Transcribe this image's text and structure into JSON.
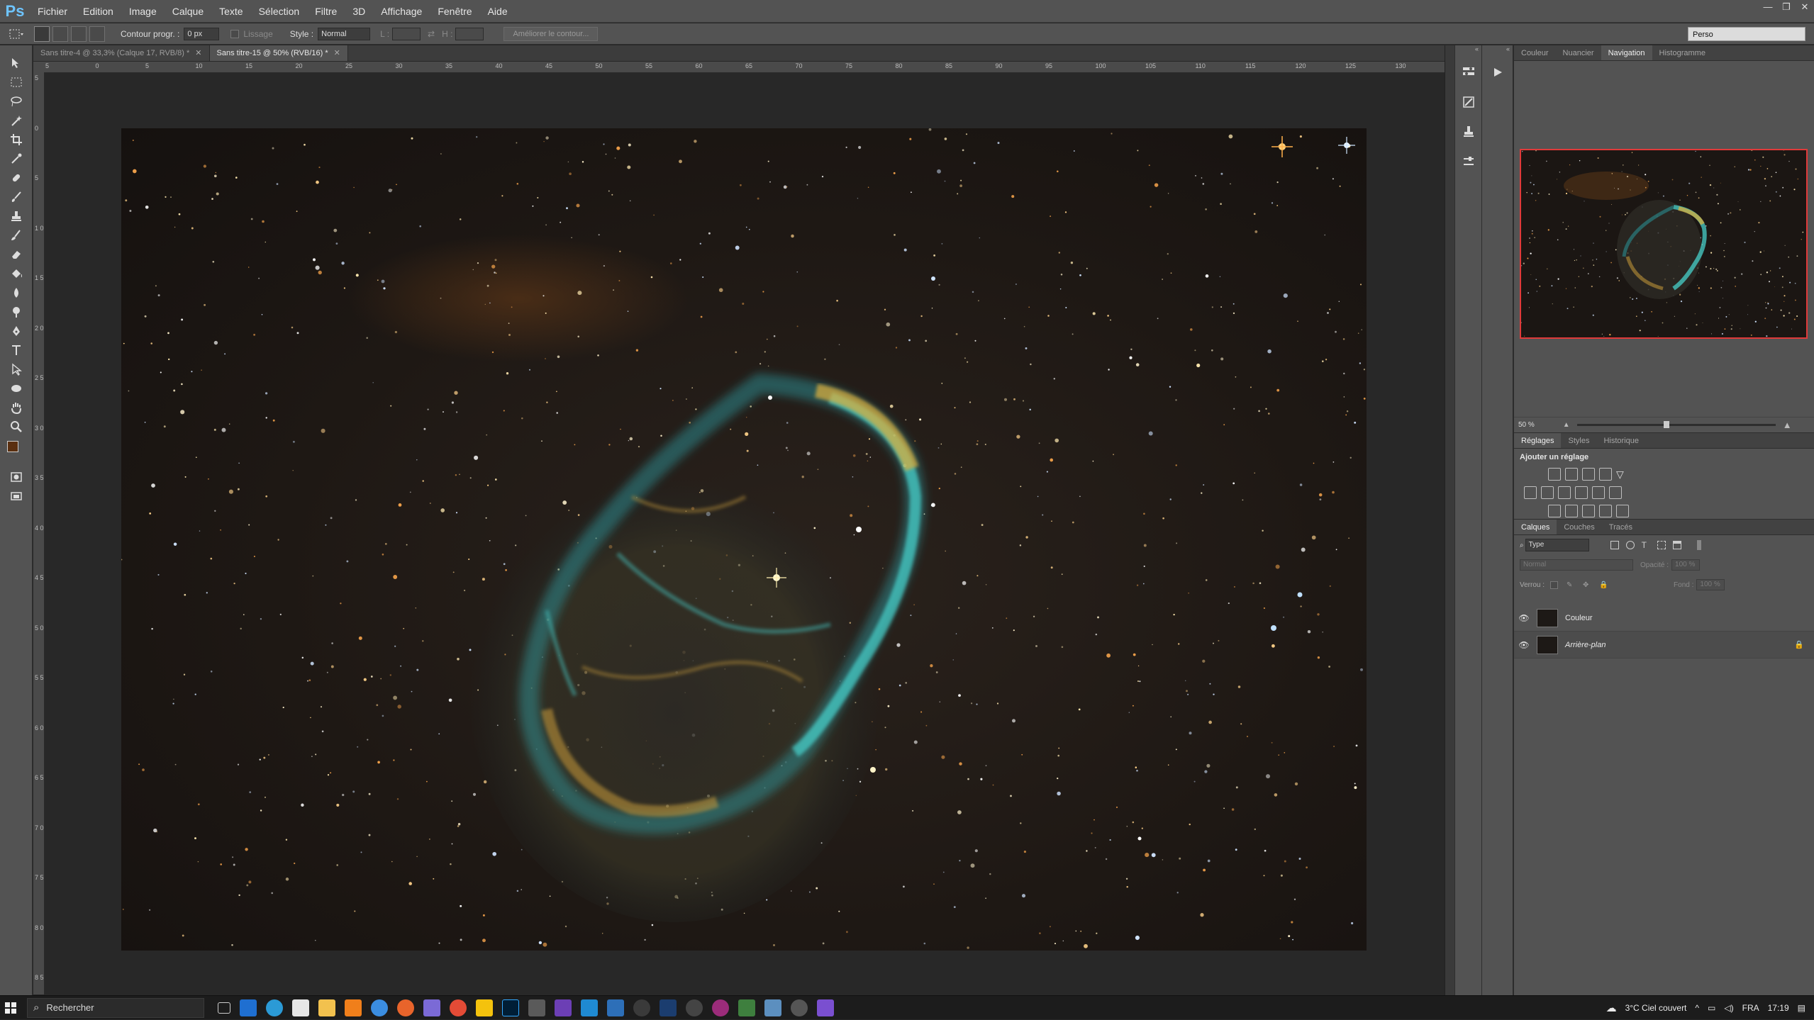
{
  "app": {
    "logo": "Ps",
    "menu": [
      "Fichier",
      "Edition",
      "Image",
      "Calque",
      "Texte",
      "Sélection",
      "Filtre",
      "3D",
      "Affichage",
      "Fenêtre",
      "Aide"
    ],
    "window_controls": [
      "—",
      "❐",
      "✕"
    ]
  },
  "options_bar": {
    "feather_label": "Contour progr. :",
    "feather_value": "0 px",
    "antialias_label": "Lissage",
    "style_label": "Style :",
    "style_value": "Normal",
    "width_label": "L :",
    "height_label": "H :",
    "refine_edge_button": "Améliorer le contour...",
    "workspace": "Perso"
  },
  "tabs": [
    {
      "label": "Sans titre-4 @ 33,3% (Calque 17, RVB/8) *",
      "active": false
    },
    {
      "label": "Sans titre-15 @ 50% (RVB/16) *",
      "active": true
    }
  ],
  "ruler": {
    "h_labels": [
      "5",
      "0",
      "5",
      "10",
      "15",
      "20",
      "25",
      "30",
      "35",
      "40",
      "45",
      "50",
      "55",
      "60",
      "65",
      "70",
      "75",
      "80",
      "85",
      "90",
      "95",
      "100",
      "105",
      "110",
      "115",
      "120",
      "125",
      "130"
    ],
    "v_labels": [
      "5",
      "0",
      "5",
      "1 0",
      "1 5",
      "2 0",
      "2 5",
      "3 0",
      "3 5",
      "4 0",
      "4 5",
      "5 0",
      "5 5",
      "6 0",
      "6 5",
      "7 0",
      "7 5",
      "8 0",
      "8 5"
    ]
  },
  "panels": {
    "top_tabs": [
      {
        "label": "Couleur",
        "active": false
      },
      {
        "label": "Nuancier",
        "active": false
      },
      {
        "label": "Navigation",
        "active": true
      },
      {
        "label": "Histogramme",
        "active": false
      }
    ],
    "navigator_zoom": "50 %",
    "adjust_tabs": [
      {
        "label": "Réglages",
        "active": true
      },
      {
        "label": "Styles",
        "active": false
      },
      {
        "label": "Historique",
        "active": false
      }
    ],
    "adjust_title": "Ajouter un réglage",
    "layer_tabs": [
      {
        "label": "Calques",
        "active": true
      },
      {
        "label": "Couches",
        "active": false
      },
      {
        "label": "Tracés",
        "active": false
      }
    ],
    "filter_kind": "Type",
    "blend_mode": "Normal",
    "opacity_label": "Opacité :",
    "opacity_value": "100 %",
    "lock_label": "Verrou :",
    "fill_label": "Fond :",
    "fill_value": "100 %",
    "layers": [
      {
        "name": "Couleur",
        "locked": false
      },
      {
        "name": "Arrière-plan",
        "locked": true
      }
    ]
  },
  "taskbar": {
    "search_placeholder": "Rechercher",
    "weather": "3°C  Ciel couvert",
    "language": "FRA",
    "time": "17:19"
  },
  "colors": {
    "ui_dark": "#535353",
    "canvas_bg": "#282828",
    "nebula_teal": "#3fd4d0",
    "nebula_gold": "#d8a431",
    "nav_frame": "#e03a3a",
    "foreground_swatch": "#5a2f10",
    "background_swatch": "#111111"
  }
}
